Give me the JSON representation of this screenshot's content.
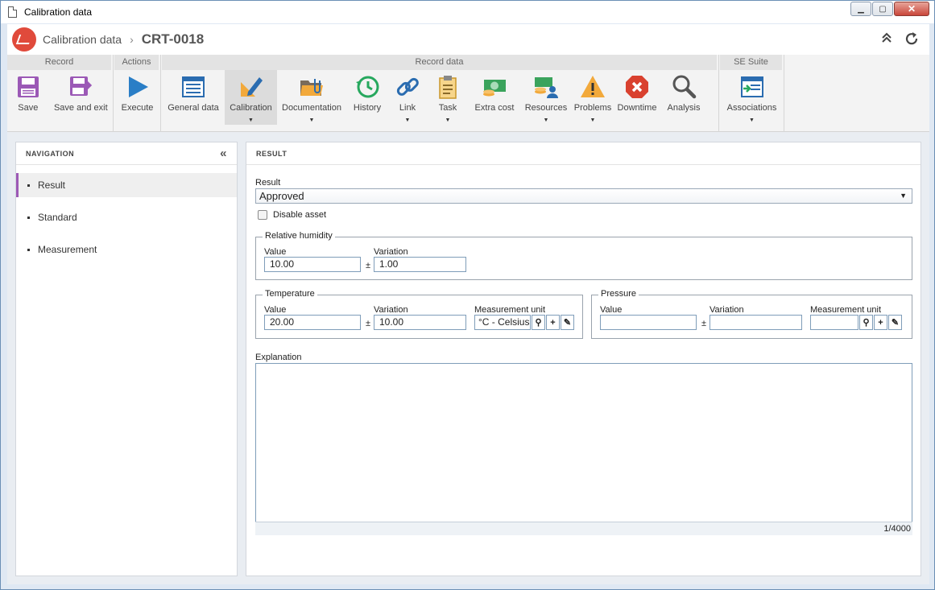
{
  "window": {
    "title": "Calibration data"
  },
  "header": {
    "app_name": "Calibration data",
    "separator": "›",
    "record_id": "CRT-0018"
  },
  "ribbon": {
    "groups": {
      "record": "Record",
      "actions": "Actions",
      "record_data": "Record data",
      "se_suite": "SE Suite"
    },
    "buttons": {
      "save": "Save",
      "save_exit": "Save and exit",
      "execute": "Execute",
      "general_data": "General data",
      "calibration": "Calibration",
      "documentation": "Documentation",
      "history": "History",
      "link": "Link",
      "task": "Task",
      "extra_cost": "Extra cost",
      "resources": "Resources",
      "problems": "Problems",
      "downtime": "Downtime",
      "analysis": "Analysis",
      "associations": "Associations"
    },
    "active": "calibration"
  },
  "navigation": {
    "title": "NAVIGATION",
    "items": [
      {
        "label": "Result"
      },
      {
        "label": "Standard"
      },
      {
        "label": "Measurement"
      }
    ],
    "active_index": 0
  },
  "result": {
    "title": "RESULT",
    "result_label": "Result",
    "result_value": "Approved",
    "disable_asset_label": "Disable asset",
    "disable_asset_checked": false,
    "humidity": {
      "legend": "Relative humidity",
      "value_label": "Value",
      "value": "10.00",
      "pm": "±",
      "variation_label": "Variation",
      "variation": "1.00"
    },
    "temperature": {
      "legend": "Temperature",
      "value_label": "Value",
      "value": "20.00",
      "pm": "±",
      "variation_label": "Variation",
      "variation": "10.00",
      "unit_label": "Measurement unit",
      "unit": "°C - Celsius"
    },
    "pressure": {
      "legend": "Pressure",
      "value_label": "Value",
      "value": "",
      "pm": "±",
      "variation_label": "Variation",
      "variation": "",
      "unit_label": "Measurement unit",
      "unit": ""
    },
    "explanation_label": "Explanation",
    "explanation": "",
    "counter": "1/4000"
  },
  "colors": {
    "accent": "#9c59b6",
    "logo": "#e04a3b",
    "window_border": "#6b8fb5"
  }
}
